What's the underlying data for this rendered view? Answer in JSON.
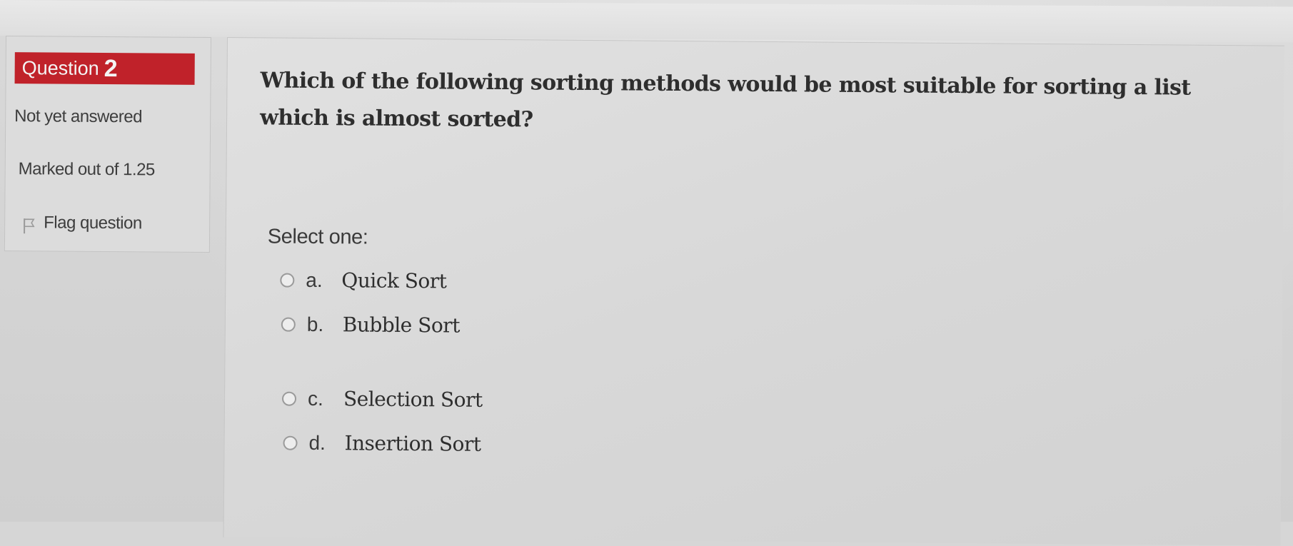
{
  "question_info": {
    "label": "Question",
    "number": "2",
    "status": "Not yet answered",
    "marks": "Marked out of 1.25",
    "flag_label": "Flag question",
    "flag_icon": "flag-icon",
    "badge_color": "#c0222a"
  },
  "question": {
    "text": "Which of the following sorting methods would be most suitable for sorting a list which is almost sorted?",
    "prompt": "Select one:",
    "options": [
      {
        "letter": "a.",
        "text": "Quick Sort",
        "selected": false
      },
      {
        "letter": "b.",
        "text": "Bubble Sort",
        "selected": false
      },
      {
        "letter": "c.",
        "text": "Selection Sort",
        "selected": false
      },
      {
        "letter": "d.",
        "text": "Insertion Sort",
        "selected": false
      }
    ]
  }
}
